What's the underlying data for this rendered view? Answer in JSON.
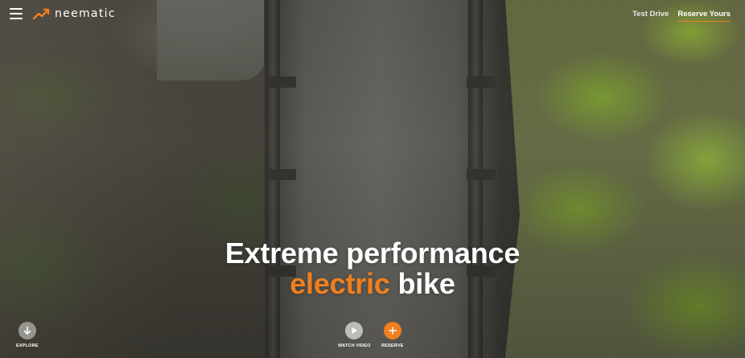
{
  "brand": {
    "name": "neematic",
    "accent_color": "#f07f1f",
    "logo_icon": "chart-zigzag-logo-icon"
  },
  "header": {
    "menu_icon": "hamburger-menu-icon",
    "nav": [
      {
        "label": "Test Drive",
        "active": false
      },
      {
        "label": "Reserve Yours",
        "active": true
      }
    ]
  },
  "hero": {
    "headline_line1": "Extreme performance",
    "headline_accent": "electric",
    "headline_rest": " bike",
    "background": "aerial photo of wooden bridge with mossy bank"
  },
  "controls": {
    "explore": {
      "label": "EXPLORE",
      "icon": "arrow-down-icon"
    },
    "watch_video": {
      "label": "WATCH VIDEO",
      "icon": "play-icon"
    },
    "reserve": {
      "label": "RESERVE",
      "icon": "plus-icon"
    }
  }
}
